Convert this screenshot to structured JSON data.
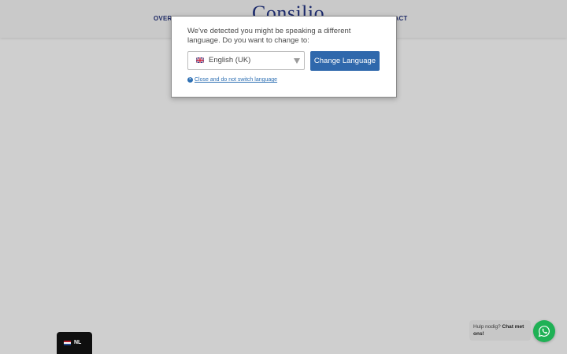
{
  "header": {
    "logo_text": "Consilio",
    "nav_left_partial": "OVER O",
    "nav_right_partial": "NTACT"
  },
  "language_modal": {
    "message": "We've detected you might be speaking a different language. Do you want to change to:",
    "selected_language": "English (UK)",
    "change_button_label": "Change Language",
    "close_link_label": "Close and do not switch language",
    "accent_color": "#2f68ac"
  },
  "language_switcher": {
    "label": "NL"
  },
  "chat_widget": {
    "text_prefix": "Hulp nodig?",
    "text_bold": "Chat met ons!",
    "button_color": "#1fb155"
  },
  "icons": [
    "flag-uk-icon",
    "chevron-down-icon",
    "close-circle-icon",
    "flag-nl-icon",
    "whatsapp-icon"
  ]
}
